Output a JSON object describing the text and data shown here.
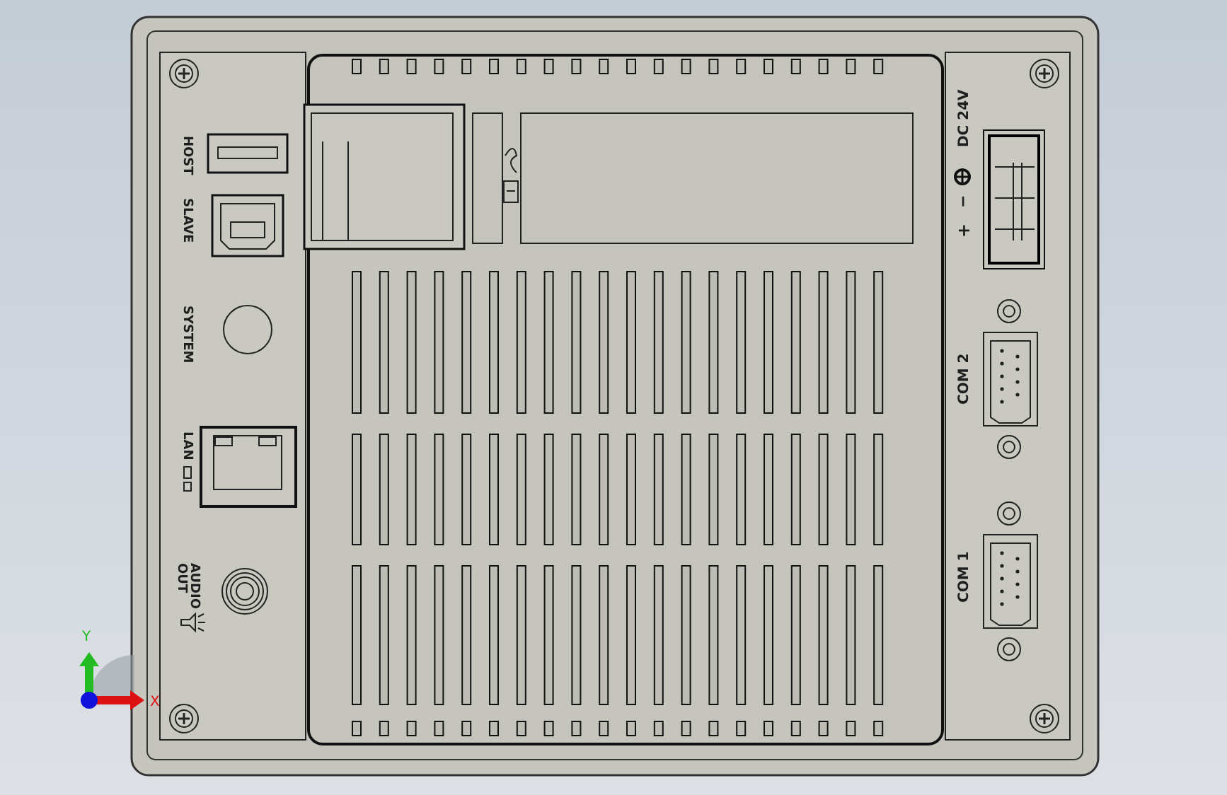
{
  "left_panel": {
    "labels": [
      {
        "text": "HOST"
      },
      {
        "text": "SLAVE"
      },
      {
        "text": "SYSTEM"
      },
      {
        "text": "LAN"
      },
      {
        "text": "AUDIO"
      },
      {
        "text": "OUT"
      }
    ]
  },
  "right_panel": {
    "labels": [
      {
        "text": "DC 24V"
      },
      {
        "text": "−"
      },
      {
        "text": "+"
      },
      {
        "text": "COM 2"
      },
      {
        "text": "COM 1"
      }
    ]
  },
  "axis_triad": {
    "y_label": "Y",
    "x_label": "X"
  }
}
